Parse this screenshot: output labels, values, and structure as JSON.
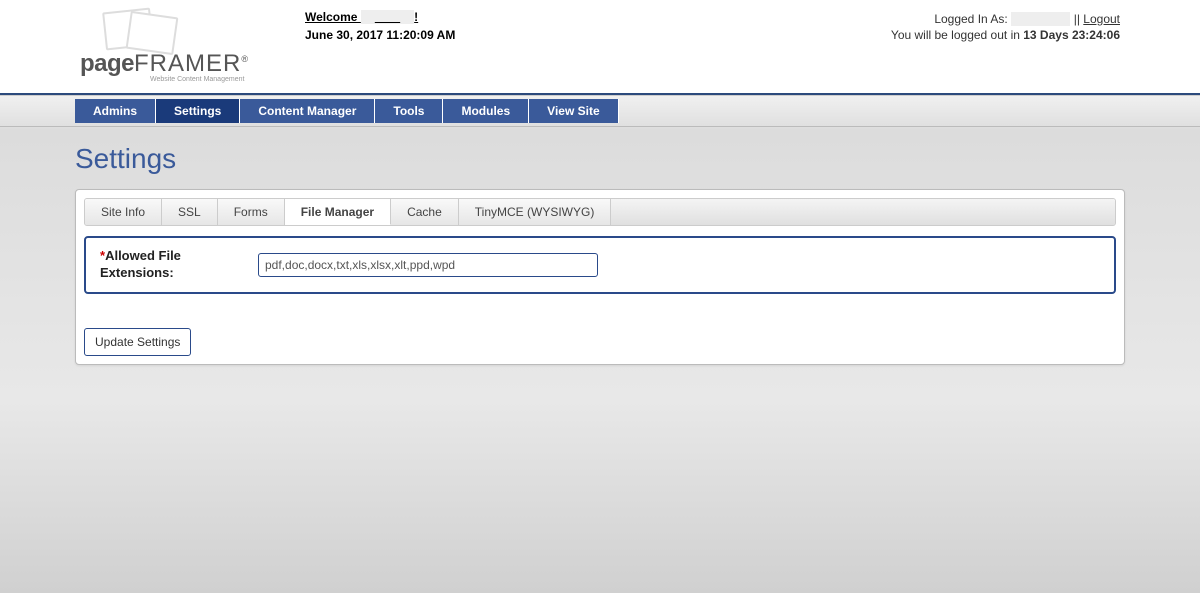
{
  "header": {
    "welcome_prefix": "Welcome ",
    "welcome_suffix": "!",
    "date_time": "June 30, 2017 11:20:09 AM",
    "logged_in_prefix": "Logged In As: ",
    "separator": " || ",
    "logout_label": "Logout",
    "timeout_prefix": "You will be logged out in ",
    "timeout_value": "13 Days 23:24:06",
    "logo_line1": "page",
    "logo_line2": "FRAMER",
    "logo_tagline": "Website Content Management"
  },
  "nav": {
    "items": [
      {
        "label": "Admins",
        "active": false
      },
      {
        "label": "Settings",
        "active": true
      },
      {
        "label": "Content Manager",
        "active": false
      },
      {
        "label": "Tools",
        "active": false
      },
      {
        "label": "Modules",
        "active": false
      },
      {
        "label": "View Site",
        "active": false
      }
    ]
  },
  "page": {
    "title": "Settings"
  },
  "subtabs": {
    "items": [
      {
        "label": "Site Info",
        "active": false
      },
      {
        "label": "SSL",
        "active": false
      },
      {
        "label": "Forms",
        "active": false
      },
      {
        "label": "File Manager",
        "active": true
      },
      {
        "label": "Cache",
        "active": false
      },
      {
        "label": "TinyMCE (WYSIWYG)",
        "active": false
      }
    ]
  },
  "form": {
    "required_mark": "*",
    "allowed_ext_label": "Allowed File Extensions:",
    "allowed_ext_value": "pdf,doc,docx,txt,xls,xlsx,xlt,ppd,wpd",
    "update_button": "Update Settings"
  }
}
